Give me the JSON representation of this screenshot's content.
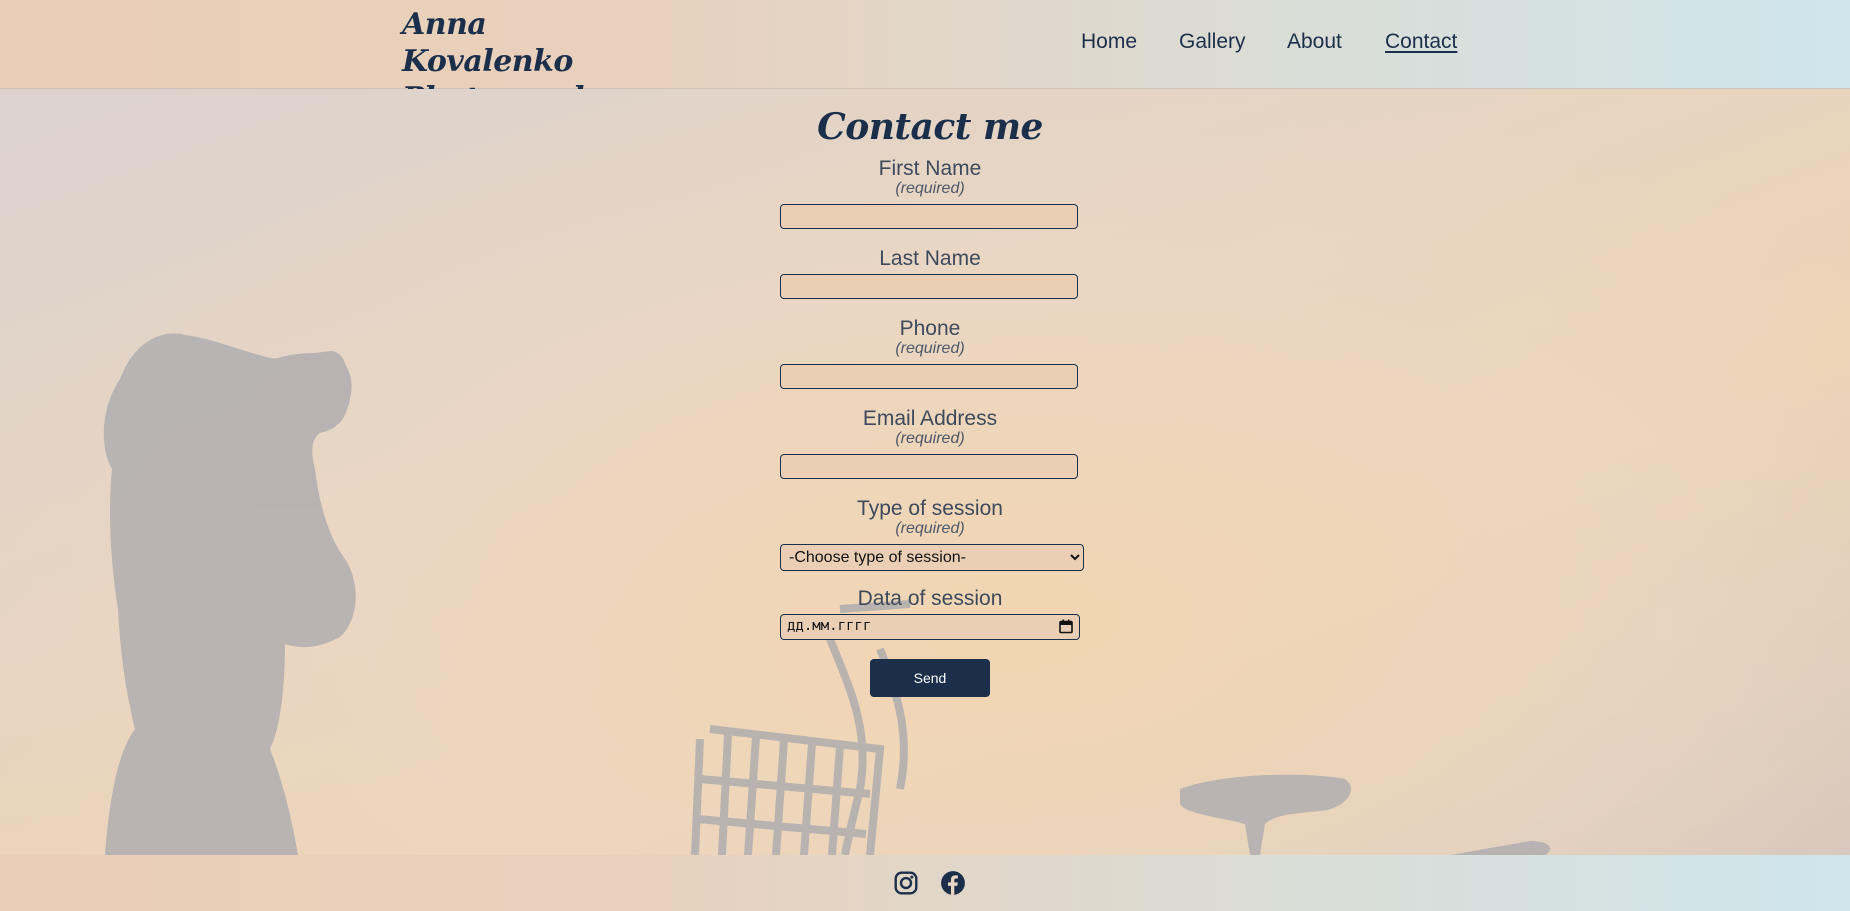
{
  "header": {
    "brand_line1": "Anna Kovalenko",
    "brand_line2": "Photography",
    "nav": [
      {
        "label": "Home",
        "active": false
      },
      {
        "label": "Gallery",
        "active": false
      },
      {
        "label": "About",
        "active": false
      },
      {
        "label": "Contact",
        "active": true
      }
    ]
  },
  "form": {
    "title": "Contact me",
    "required_note": "(required)",
    "fields": {
      "first_name": {
        "label": "First Name",
        "value": ""
      },
      "last_name": {
        "label": "Last Name",
        "value": ""
      },
      "phone": {
        "label": "Phone",
        "value": ""
      },
      "email": {
        "label": "Email Address",
        "value": ""
      },
      "session_type": {
        "label": "Type of session",
        "selected": "-Choose type of session-"
      },
      "session_date": {
        "label": "Data of session",
        "placeholder": "дд.мм.гггг"
      }
    },
    "submit_label": "Send"
  },
  "footer": {
    "icons": [
      "instagram-icon",
      "facebook-icon"
    ]
  },
  "colors": {
    "primary": "#1b2f4b",
    "input_bg": "#ebcfb5",
    "header_left": "#ebceb6",
    "header_right": "#cfe6ec"
  }
}
